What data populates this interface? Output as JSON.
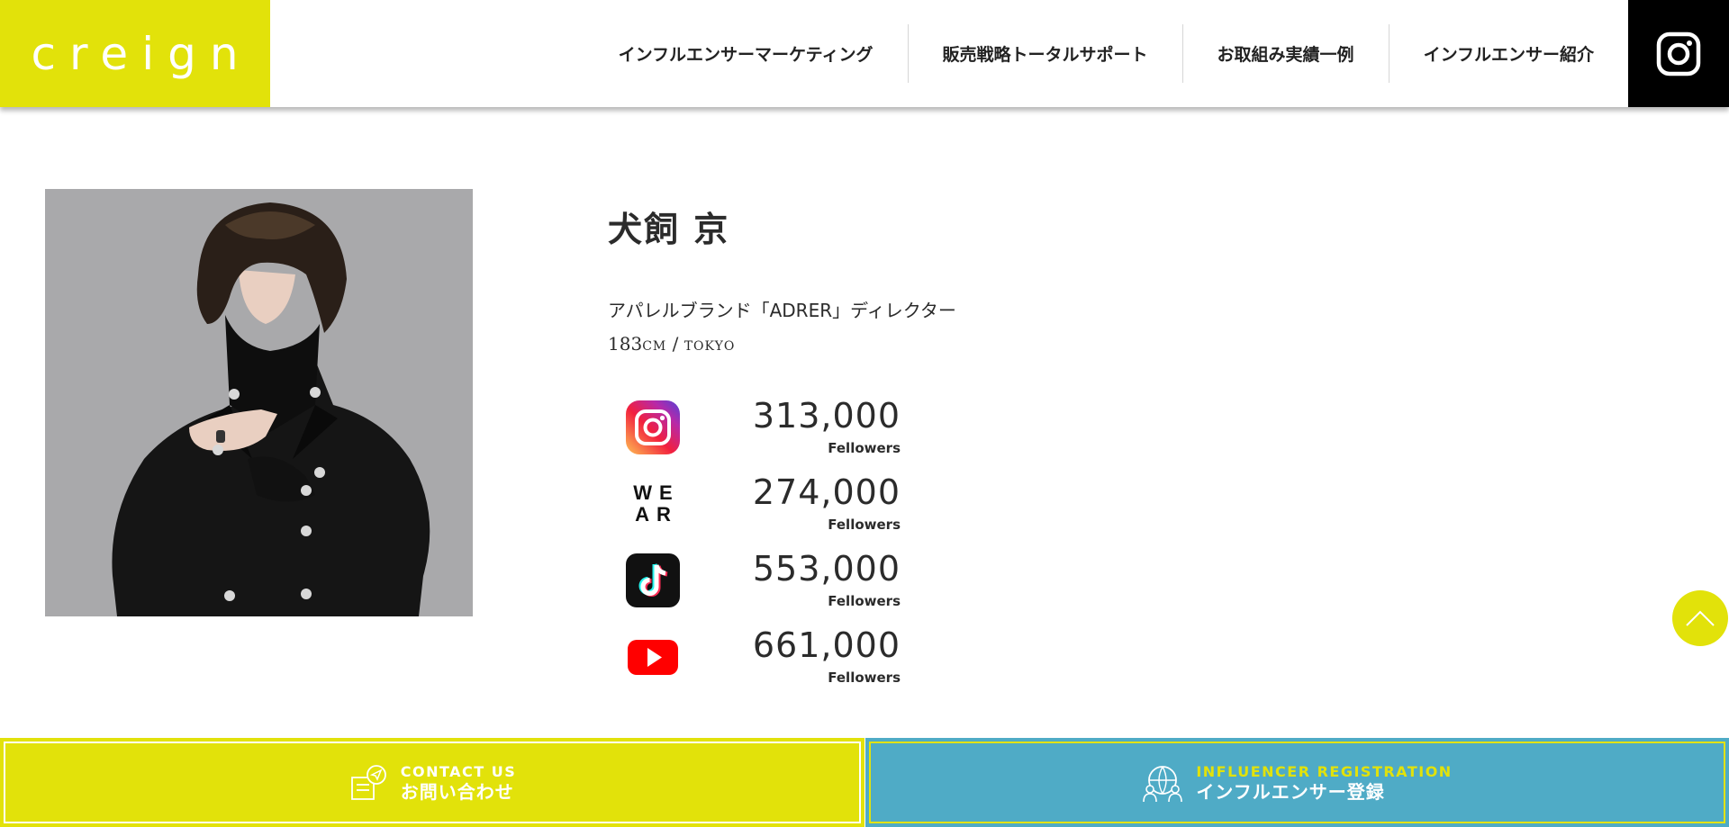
{
  "brand": {
    "logo_text": "creign",
    "accent_color": "#e2e20a",
    "secondary_color": "#4fabc6"
  },
  "nav": {
    "items": [
      {
        "label": "インフルエンサーマーケティング"
      },
      {
        "label": "販売戦略トータルサポート"
      },
      {
        "label": "お取組み実績一例"
      },
      {
        "label": "インフルエンサー紹介"
      }
    ],
    "instagram_icon": "instagram-icon"
  },
  "profile": {
    "name": "犬飼 京",
    "description": "アパレルブランド「ADRER」ディレクター",
    "height": "183",
    "height_unit": "cm",
    "location": "tokyo",
    "photo_alt": "portrait"
  },
  "stats": [
    {
      "platform_icon": "instagram-icon",
      "value": "313,000",
      "label": "Fellowers"
    },
    {
      "platform_icon": "wear-icon",
      "value": "274,000",
      "label": "Fellowers"
    },
    {
      "platform_icon": "tiktok-icon",
      "value": "553,000",
      "label": "Fellowers"
    },
    {
      "platform_icon": "youtube-icon",
      "value": "661,000",
      "label": "Fellowers"
    }
  ],
  "wear_logo": {
    "line1": "WE",
    "line2": "AR"
  },
  "footer": {
    "contact": {
      "en": "CONTACT US",
      "jp": "お問い合わせ"
    },
    "register": {
      "en": "INFLUENCER REGISTRATION",
      "jp": "インフルエンサー登録"
    }
  }
}
